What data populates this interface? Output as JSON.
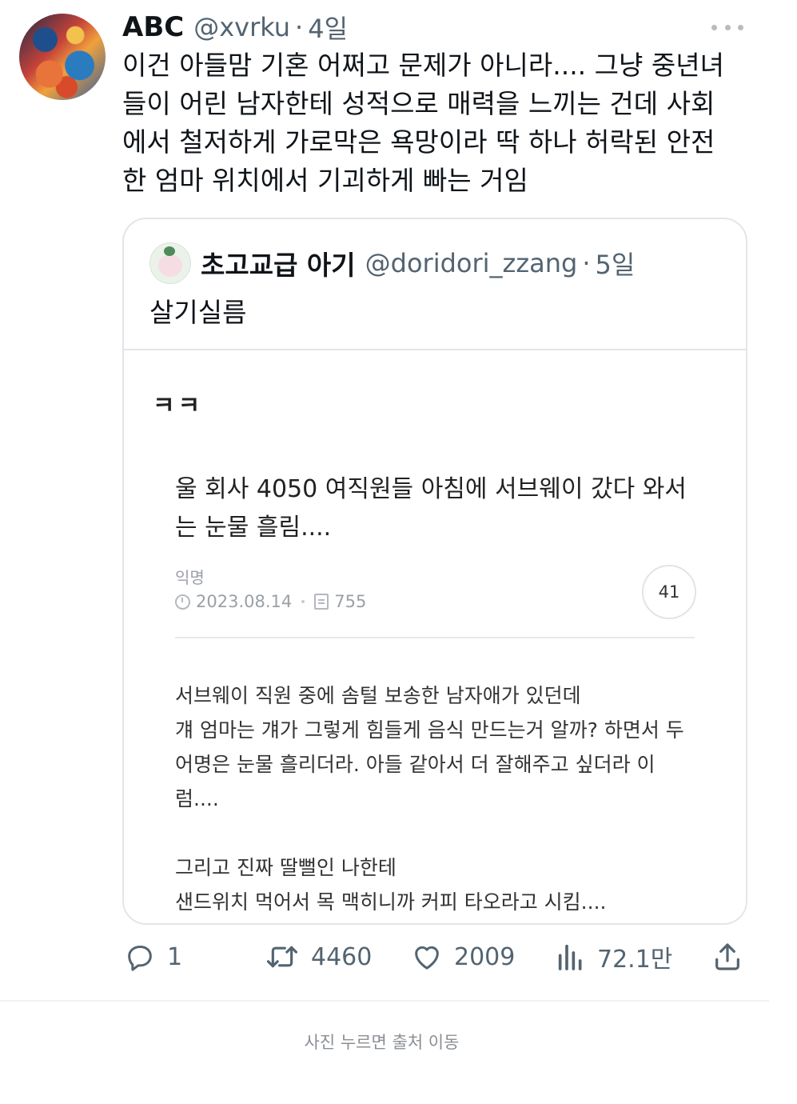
{
  "tweet": {
    "display_name": "ABC",
    "handle": "@xvrku",
    "separator": "·",
    "time": "4일",
    "lines": [
      "이건 아들맘 기혼 어쩌고 문제가 아니라.... 그냥 중년녀",
      "들이 어린 남자한테 성적으로 매력을 느끼는 건데 사회",
      "에서 철저하게 가로막은 욕망이라 딱 하나 허락된 안전",
      "한 엄마 위치에서 기괴하게 빠는 거임"
    ]
  },
  "quote": {
    "display_name": "초고교급 아기",
    "handle": "@doridori_zzang",
    "separator": "·",
    "time": "5일",
    "text": "살기실름"
  },
  "screenshot": {
    "kk": "ㅋㅋ",
    "post_title_lines": [
      "울 회사 4050 여직원들 아침에 서브웨이 갔다 와서",
      "는 눈물 흘림...."
    ],
    "author": "익명",
    "date": "2023.08.14",
    "views": "755",
    "comments": "41",
    "body_lines": [
      "서브웨이 직원 중에 솜털 보송한 남자애가 있던데",
      "걔 엄마는 걔가 그렇게 힘들게 음식 만드는거 알까? 하면서 두",
      "어명은 눈물 흘리더라. 아들 같아서 더 잘해주고 싶더라 이",
      "럼....",
      "",
      "그리고 진짜 딸뻘인 나한테",
      "샌드위치 먹어서 목 맥히니까 커피 타오라고 시킴...."
    ]
  },
  "actions": {
    "replies": "1",
    "retweets": "4460",
    "likes": "2009",
    "views": "72.1만"
  },
  "footer": "사진 누르면 출처 이동",
  "colors": {
    "text_primary": "#0f1419",
    "text_secondary": "#536471",
    "border": "#e1e6ea"
  },
  "icons": [
    "more-icon",
    "reply-icon",
    "retweet-icon",
    "like-icon",
    "views-icon",
    "share-icon",
    "clock-icon",
    "view-count-icon"
  ]
}
